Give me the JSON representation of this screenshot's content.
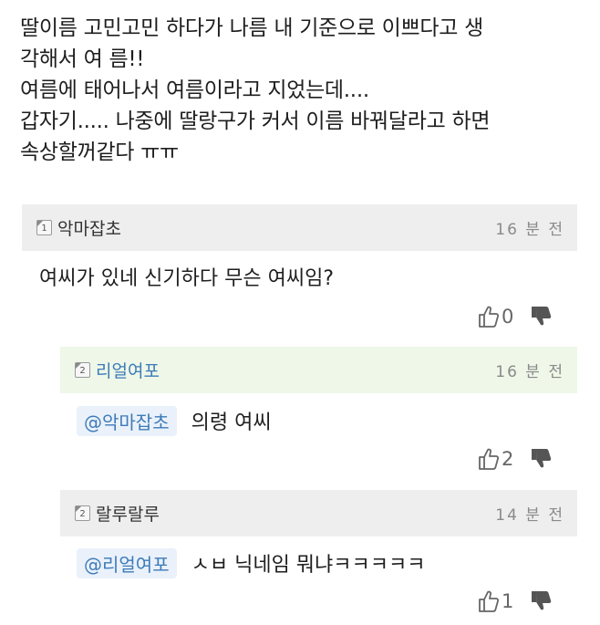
{
  "post": {
    "lines": [
      "딸이름 고민고민 하다가 나름 내 기준으로 이쁘다고 생",
      "각해서 여 름!!",
      "여름에 태어나서 여름이라고 지었는데....",
      "갑자기..... 나중에 딸랑구가 커서 이름 바꿔달라고 하면",
      "속상할꺼같다 ㅠㅠ"
    ]
  },
  "comments": [
    {
      "grade": "1",
      "nickname": "악마잡초",
      "time": "16 분 전",
      "mention": "",
      "text": "여씨가 있네 신기하다 무슨 여씨임?",
      "likes": "0"
    },
    {
      "grade": "2",
      "nickname": "리얼여포",
      "time": "16 분 전",
      "mention": "@악마잡초",
      "text": "의령 여씨",
      "likes": "2"
    },
    {
      "grade": "2",
      "nickname": "랄루랄루",
      "time": "14 분 전",
      "mention": "@리얼여포",
      "text": "ㅅㅂ 닉네임 뭐냐ㅋㅋㅋㅋㅋ",
      "likes": "1"
    }
  ],
  "colors": {
    "reply_highlight": "#eef7e8",
    "mention": "#3d7bb8",
    "header_bg": "#eeeeee"
  },
  "icons": {
    "like": "thumbs-up-icon",
    "dislike": "thumbs-down-icon",
    "grade": "member-grade-icon"
  }
}
